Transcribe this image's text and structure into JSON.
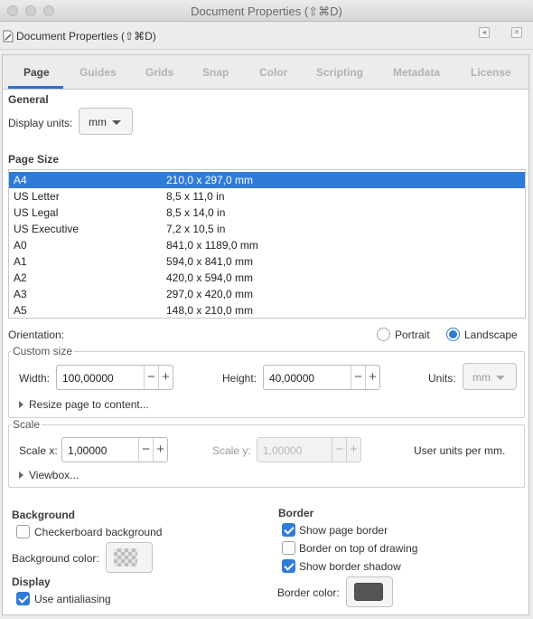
{
  "window": {
    "title": "Document Properties (⇧⌘D)"
  },
  "dock": {
    "title": "Document Properties (⇧⌘D)",
    "icon": "document-properties-icon"
  },
  "tabs": [
    {
      "label": "Page",
      "active": true
    },
    {
      "label": "Guides",
      "active": false
    },
    {
      "label": "Grids",
      "active": false
    },
    {
      "label": "Snap",
      "active": false
    },
    {
      "label": "Color",
      "active": false
    },
    {
      "label": "Scripting",
      "active": false
    },
    {
      "label": "Metadata",
      "active": false
    },
    {
      "label": "License",
      "active": false
    }
  ],
  "general": {
    "heading": "General",
    "display_units_label": "Display units:",
    "display_units_value": "mm"
  },
  "page_size": {
    "heading": "Page Size",
    "rows": [
      {
        "name": "A4",
        "size": "210,0 x 297,0 mm",
        "selected": true
      },
      {
        "name": "US Letter",
        "size": "8,5 x 11,0 in",
        "selected": false
      },
      {
        "name": "US Legal",
        "size": "8,5 x 14,0 in",
        "selected": false
      },
      {
        "name": "US Executive",
        "size": "7,2 x 10,5 in",
        "selected": false
      },
      {
        "name": "A0",
        "size": "841,0 x 1189,0 mm",
        "selected": false
      },
      {
        "name": "A1",
        "size": "594,0 x 841,0 mm",
        "selected": false
      },
      {
        "name": "A2",
        "size": "420,0 x 594,0 mm",
        "selected": false
      },
      {
        "name": "A3",
        "size": "297,0 x 420,0 mm",
        "selected": false
      },
      {
        "name": "A5",
        "size": "148,0 x 210,0 mm",
        "selected": false
      }
    ]
  },
  "orientation": {
    "label": "Orientation:",
    "portrait": "Portrait",
    "landscape": "Landscape",
    "selected": "landscape"
  },
  "custom_size": {
    "legend": "Custom size",
    "width_label": "Width:",
    "width_value": "100,00000",
    "height_label": "Height:",
    "height_value": "40,00000",
    "units_label": "Units:",
    "units_value": "mm",
    "resize_label": "Resize page to content..."
  },
  "scale": {
    "legend": "Scale",
    "scale_x_label": "Scale x:",
    "scale_x_value": "1,00000",
    "scale_y_label": "Scale y:",
    "scale_y_value": "1,00000",
    "user_units_label": "User units per mm.",
    "viewbox_label": "Viewbox..."
  },
  "background": {
    "heading": "Background",
    "checkerboard_label": "Checkerboard background",
    "checkerboard_checked": false,
    "color_label": "Background color:"
  },
  "display": {
    "heading": "Display",
    "antialiasing_label": "Use antialiasing",
    "antialiasing_checked": true
  },
  "border": {
    "heading": "Border",
    "show_border_label": "Show page border",
    "show_border_checked": true,
    "on_top_label": "Border on top of drawing",
    "on_top_checked": false,
    "shadow_label": "Show border shadow",
    "shadow_checked": true,
    "color_label": "Border color:",
    "color": "#555555"
  },
  "colors": {
    "accent": "#2f7cd8",
    "tab_underline": "#2f6fd6"
  }
}
